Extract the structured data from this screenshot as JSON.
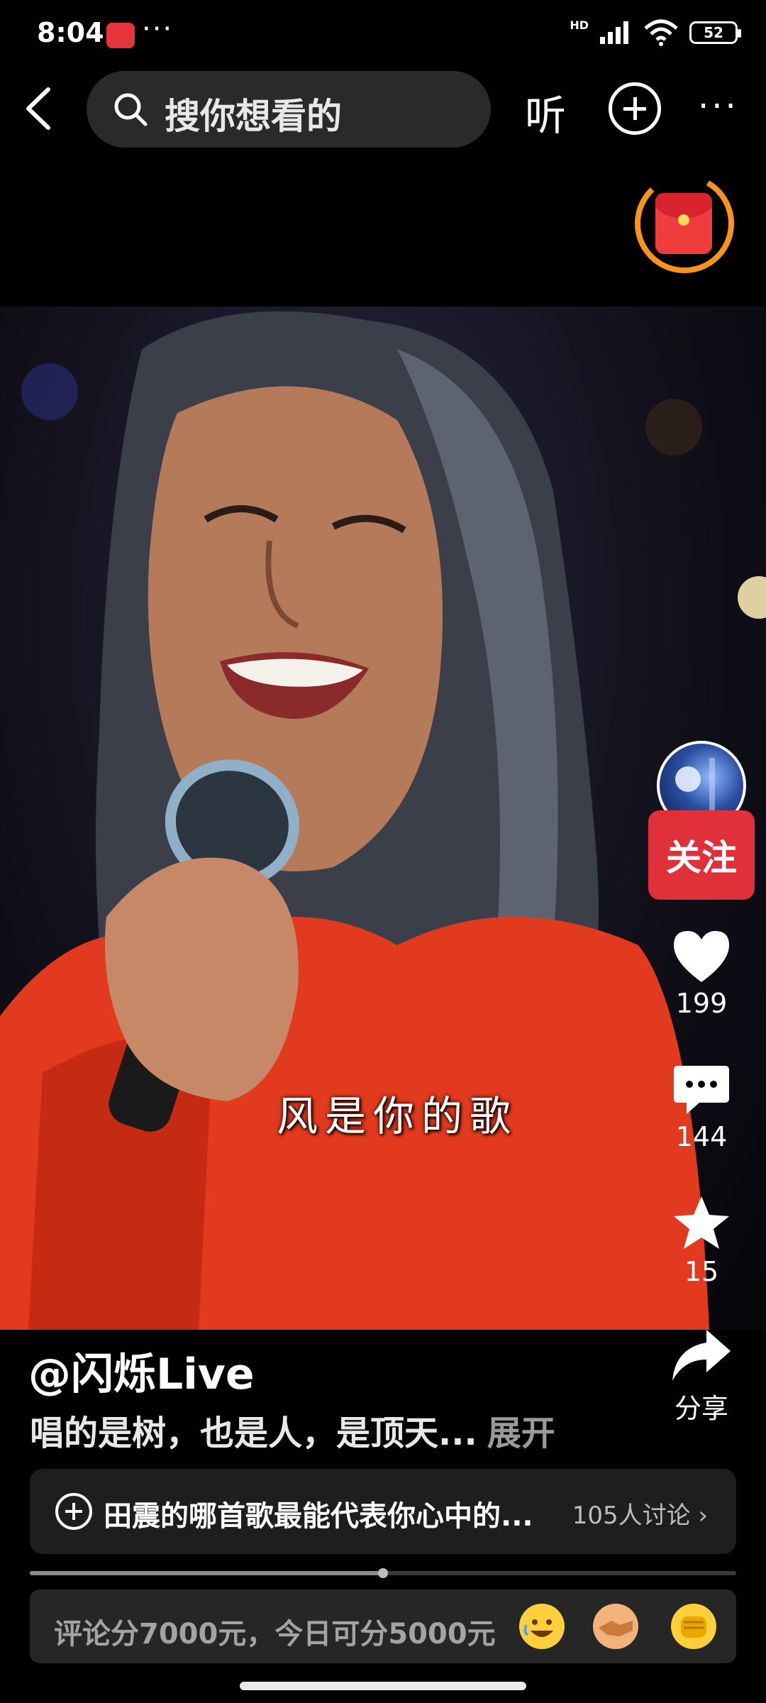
{
  "status_bar": {
    "time": "8:04",
    "more": "···",
    "network": "HD",
    "battery": "52"
  },
  "top_bar": {
    "search_placeholder": "搜你想看的",
    "listen_label": "听",
    "more_label": "···"
  },
  "video": {
    "lyric": "风是你的歌"
  },
  "right_rail": {
    "follow_label": "关注",
    "like_count": "199",
    "comment_count": "144",
    "favorite_count": "15",
    "share_label": "分享"
  },
  "caption": {
    "author": "@闪烁Live",
    "text": "唱的是树，也是人，是顶天...",
    "expand": "展开"
  },
  "topic": {
    "text": "田震的哪首歌最能代表你心中的...",
    "count": "105人讨论 ›"
  },
  "progress": {
    "fraction": 0.5
  },
  "comment_bar": {
    "placeholder": "评论分7000元，今日可分5000元"
  },
  "colors": {
    "follow": "#e0303a",
    "red_packet": "#f03c3c",
    "ring": "#f7931e"
  }
}
